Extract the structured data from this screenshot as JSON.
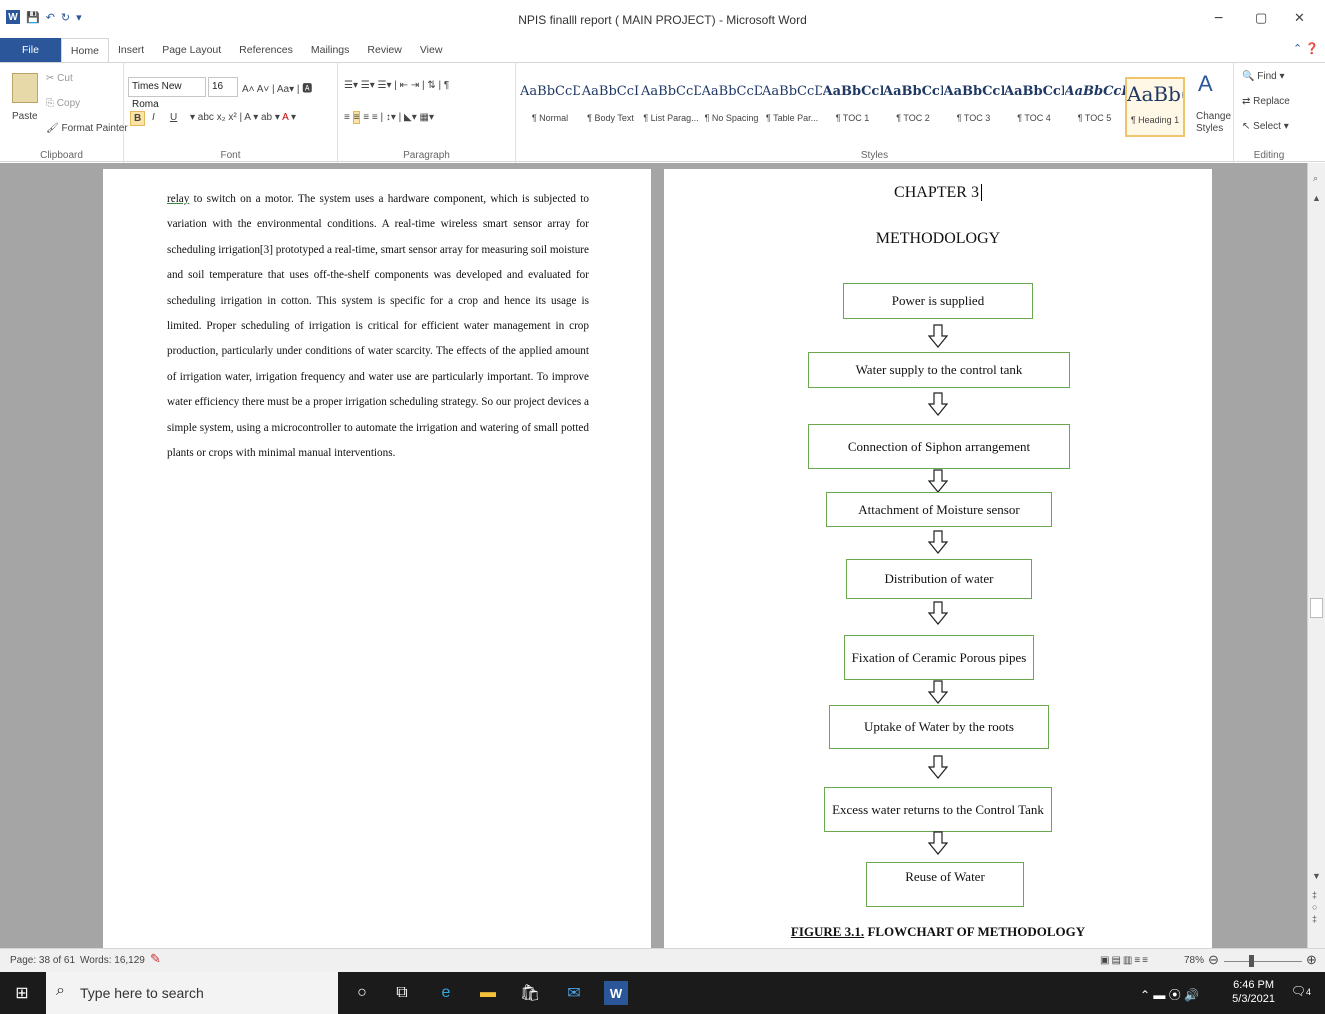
{
  "window": {
    "title": "NPIS finalll report ( MAIN PROJECT) - Microsoft Word",
    "min": "−",
    "max": "▢",
    "close": "✕"
  },
  "quick_access": {
    "app_icon": "W",
    "save": "💾",
    "undo": "↶",
    "redo": "↻",
    "more": "▾"
  },
  "tabs": [
    "File",
    "Home",
    "Insert",
    "Page Layout",
    "References",
    "Mailings",
    "Review",
    "View"
  ],
  "ribbon": {
    "clipboard": {
      "paste": "Paste",
      "cut": "Cut",
      "copy": "Copy",
      "format_painter": "Format Painter",
      "label": "Clipboard"
    },
    "font": {
      "name": "Times New Roma",
      "size": "16",
      "label": "Font",
      "bold": "B",
      "italic": "I",
      "underline": "U"
    },
    "paragraph": {
      "label": "Paragraph"
    },
    "styles": {
      "label": "Styles",
      "items": [
        {
          "sample": "AaBbCcD",
          "name": "¶ Normal"
        },
        {
          "sample": "AaBbCcI",
          "name": "¶ Body Text"
        },
        {
          "sample": "AaBbCcD",
          "name": "¶ List Parag..."
        },
        {
          "sample": "AaBbCcD",
          "name": "¶ No Spacing"
        },
        {
          "sample": "AaBbCcD",
          "name": "¶ Table Par..."
        },
        {
          "sample": "AaBbCcI",
          "name": "¶ TOC 1"
        },
        {
          "sample": "AaBbCcI",
          "name": "¶ TOC 2"
        },
        {
          "sample": "AaBbCcI",
          "name": "¶ TOC 3"
        },
        {
          "sample": "AaBbCcI",
          "name": "¶ TOC 4"
        },
        {
          "sample": "AaBbCcD",
          "name": "¶ TOC 5"
        },
        {
          "sample": "AaBb(",
          "name": "¶ Heading 1"
        }
      ],
      "change_styles": "Change Styles"
    },
    "editing": {
      "find": "Find",
      "replace": "Replace",
      "select": "Select",
      "label": "Editing"
    }
  },
  "left_page": {
    "text_first_word": "relay",
    "text": " to switch on a motor. The system uses a hardware component, which is subjected to variation with the environmental conditions. A real-time wireless smart sensor array for scheduling irrigation[3] prototyped a real-time, smart sensor array for measuring soil moisture and soil temperature that uses off-the-shelf components was developed and evaluated for scheduling irrigation in cotton. This system is specific for a crop and hence its usage is limited. Proper scheduling of irrigation is critical for efficient water management in crop production, particularly under conditions of water scarcity. The effects of the applied amount of irrigation water, irrigation frequency and water use are particularly important. To improve water efficiency there must be a proper irrigation scheduling strategy. So our project devices a simple system, using a microcontroller to automate the irrigation and watering of small potted plants or crops with minimal manual interventions."
  },
  "right_page": {
    "chapter": "CHAPTER 3",
    "heading": "METHODOLOGY",
    "flow": [
      "Power is supplied",
      "Water supply to the control tank",
      "Connection of Siphon arrangement",
      "Attachment of Moisture sensor",
      "Distribution of water",
      "Fixation of Ceramic Porous pipes",
      "Uptake of Water by the roots",
      "Excess water returns to the Control Tank",
      "Reuse of Water"
    ],
    "caption_u": "FIGURE 3.1.",
    "caption_rest": " FLOWCHART OF METHODOLOGY"
  },
  "status": {
    "page": "Page: 38 of 61",
    "words": "Words: 16,129",
    "zoom": "78%"
  },
  "taskbar": {
    "search_placeholder": "Type here to search",
    "time": "6:46 PM",
    "date": "5/3/2021",
    "notifications": "4"
  }
}
